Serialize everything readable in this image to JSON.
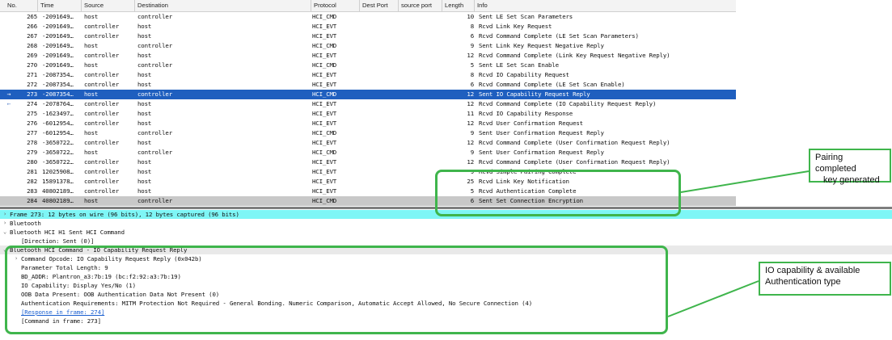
{
  "headers": {
    "no": "No.",
    "time": "Time",
    "source": "Source",
    "destination": "Destination",
    "protocol": "Protocol",
    "dest_port": "Dest Port",
    "source_port": "source port",
    "length": "Length",
    "info": "Info"
  },
  "packets": [
    {
      "no": "265",
      "time": "-2091649…",
      "source": "host",
      "destination": "controller",
      "protocol": "HCI_CMD",
      "length": "10",
      "info": "Sent LE Set Scan Parameters"
    },
    {
      "no": "266",
      "time": "-2091649…",
      "source": "controller",
      "destination": "host",
      "protocol": "HCI_EVT",
      "length": "8",
      "info": "Rcvd Link Key Request"
    },
    {
      "no": "267",
      "time": "-2091649…",
      "source": "controller",
      "destination": "host",
      "protocol": "HCI_EVT",
      "length": "6",
      "info": "Rcvd Command Complete (LE Set Scan Parameters)"
    },
    {
      "no": "268",
      "time": "-2091649…",
      "source": "host",
      "destination": "controller",
      "protocol": "HCI_CMD",
      "length": "9",
      "info": "Sent Link Key Request Negative Reply"
    },
    {
      "no": "269",
      "time": "-2091649…",
      "source": "controller",
      "destination": "host",
      "protocol": "HCI_EVT",
      "length": "12",
      "info": "Rcvd Command Complete (Link Key Request Negative Reply)"
    },
    {
      "no": "270",
      "time": "-2091649…",
      "source": "host",
      "destination": "controller",
      "protocol": "HCI_CMD",
      "length": "5",
      "info": "Sent LE Set Scan Enable"
    },
    {
      "no": "271",
      "time": "-2087354…",
      "source": "controller",
      "destination": "host",
      "protocol": "HCI_EVT",
      "length": "8",
      "info": "Rcvd IO Capability Request"
    },
    {
      "no": "272",
      "time": "-2087354…",
      "source": "controller",
      "destination": "host",
      "protocol": "HCI_EVT",
      "length": "6",
      "info": "Rcvd Command Complete (LE Set Scan Enable)"
    },
    {
      "no": "273",
      "time": "-2087354…",
      "source": "host",
      "destination": "controller",
      "protocol": "HCI_CMD",
      "length": "12",
      "info": "Sent IO Capability Request Reply",
      "selected": true,
      "mark": "→"
    },
    {
      "no": "274",
      "time": "-2078764…",
      "source": "controller",
      "destination": "host",
      "protocol": "HCI_EVT",
      "length": "12",
      "info": "Rcvd Command Complete (IO Capability Request Reply)",
      "mark": "←"
    },
    {
      "no": "275",
      "time": "-1623497…",
      "source": "controller",
      "destination": "host",
      "protocol": "HCI_EVT",
      "length": "11",
      "info": "Rcvd IO Capability Response"
    },
    {
      "no": "276",
      "time": "-6012954…",
      "source": "controller",
      "destination": "host",
      "protocol": "HCI_EVT",
      "length": "12",
      "info": "Rcvd User Confirmation Request"
    },
    {
      "no": "277",
      "time": "-6012954…",
      "source": "host",
      "destination": "controller",
      "protocol": "HCI_CMD",
      "length": "9",
      "info": "Sent User Confirmation Request Reply"
    },
    {
      "no": "278",
      "time": "-3650722…",
      "source": "controller",
      "destination": "host",
      "protocol": "HCI_EVT",
      "length": "12",
      "info": "Rcvd Command Complete (User Confirmation Request Reply)"
    },
    {
      "no": "279",
      "time": "-3650722…",
      "source": "host",
      "destination": "controller",
      "protocol": "HCI_CMD",
      "length": "9",
      "info": "Sent User Confirmation Request Reply"
    },
    {
      "no": "280",
      "time": "-3650722…",
      "source": "controller",
      "destination": "host",
      "protocol": "HCI_EVT",
      "length": "12",
      "info": "Rcvd Command Complete (User Confirmation Request Reply)"
    },
    {
      "no": "281",
      "time": "12025908…",
      "source": "controller",
      "destination": "host",
      "protocol": "HCI_EVT",
      "length": "9",
      "info": "Rcvd Simple Pairing Complete"
    },
    {
      "no": "282",
      "time": "15891378…",
      "source": "controller",
      "destination": "host",
      "protocol": "HCI_EVT",
      "length": "25",
      "info": "Rcvd Link Key Notification"
    },
    {
      "no": "283",
      "time": "40802189…",
      "source": "controller",
      "destination": "host",
      "protocol": "HCI_EVT",
      "length": "5",
      "info": "Rcvd Authentication Complete"
    },
    {
      "no": "284",
      "time": "40802189…",
      "source": "host",
      "destination": "controller",
      "protocol": "HCI_CMD",
      "length": "6",
      "info": "Sent Set Connection Encryption",
      "partial": true
    }
  ],
  "details": [
    {
      "text": "Frame 273: 12 bytes on wire (96 bits), 12 bytes captured (96 bits)",
      "indent": 0,
      "toggle": "›",
      "style": "hl"
    },
    {
      "text": "Bluetooth",
      "indent": 0,
      "toggle": "›"
    },
    {
      "text": "Bluetooth HCI H1 Sent HCI Command",
      "indent": 0,
      "toggle": "⌄"
    },
    {
      "text": "[Direction: Sent (0)]",
      "indent": 1
    },
    {
      "text": "Bluetooth HCI Command - IO Capability Request Reply",
      "indent": 0,
      "toggle": "⌄",
      "style": "band"
    },
    {
      "text": "Command Opcode: IO Capability Request Reply (0x042b)",
      "indent": 1,
      "toggle": "›"
    },
    {
      "text": "Parameter Total Length: 9",
      "indent": 1
    },
    {
      "text": "BD_ADDR: Plantron_a3:7b:19 (bc:f2:92:a3:7b:19)",
      "indent": 1
    },
    {
      "text": "IO Capability: Display Yes/No (1)",
      "indent": 1
    },
    {
      "text": "OOB Data Present: OOB Authentication Data Not Present (0)",
      "indent": 1
    },
    {
      "text": "Authentication Requirements: MITM Protection Not Required - General Bonding. Numeric Comparison, Automatic Accept Allowed, No Secure Connection (4)",
      "indent": 1
    },
    {
      "text": "[Response in frame: 274]",
      "indent": 1,
      "style": "link"
    },
    {
      "text": "[Command in frame: 273]",
      "indent": 1
    }
  ],
  "callouts": {
    "pairing": {
      "line1": "Pairing completed",
      "line2": "key generated"
    },
    "io": {
      "line1": "IO capability & available",
      "line2": "Authentication type"
    }
  },
  "colors": {
    "accent": "#3fb54c",
    "selected_row": "#1f5fbf",
    "frame_highlight": "#7ef6f6"
  }
}
